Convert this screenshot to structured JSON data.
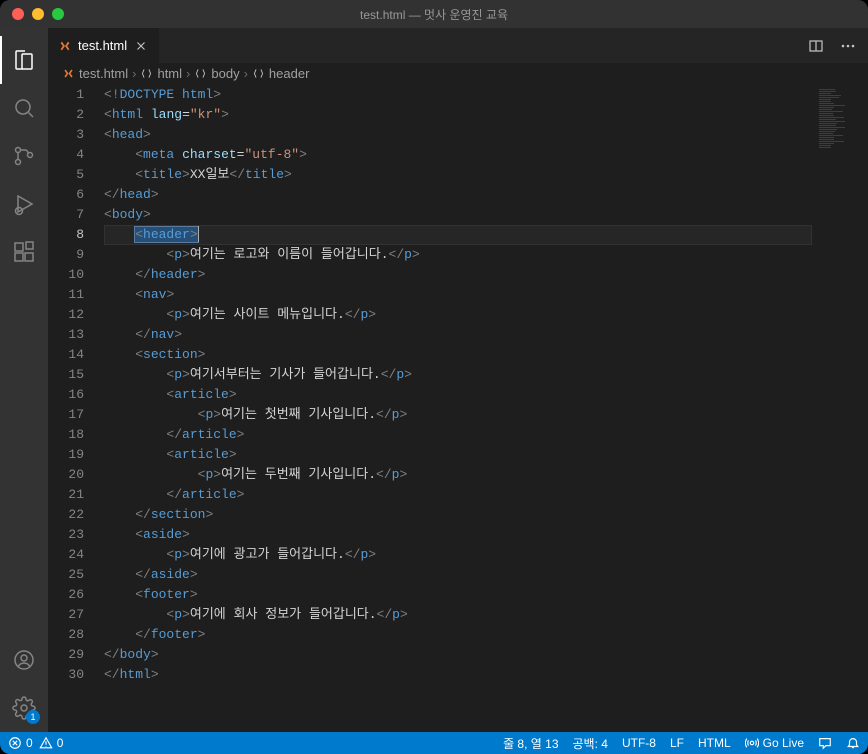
{
  "window": {
    "title": "test.html — 멋사 운영진 교육"
  },
  "tabs": [
    {
      "label": "test.html"
    }
  ],
  "breadcrumbs": [
    "test.html",
    "html",
    "body",
    "header"
  ],
  "cursor": {
    "line": 8,
    "column": 13
  },
  "code": {
    "lines": [
      {
        "n": 1,
        "indent": 0,
        "tokens": [
          {
            "t": "angle",
            "v": "<!"
          },
          {
            "t": "doctype",
            "v": "DOCTYPE html"
          },
          {
            "t": "angle",
            "v": ">"
          }
        ]
      },
      {
        "n": 2,
        "indent": 0,
        "tokens": [
          {
            "t": "angle",
            "v": "<"
          },
          {
            "t": "tag",
            "v": "html"
          },
          {
            "t": "text",
            "v": " "
          },
          {
            "t": "attr",
            "v": "lang"
          },
          {
            "t": "punct",
            "v": "="
          },
          {
            "t": "str",
            "v": "\"kr\""
          },
          {
            "t": "angle",
            "v": ">"
          }
        ]
      },
      {
        "n": 3,
        "indent": 0,
        "tokens": [
          {
            "t": "angle",
            "v": "<"
          },
          {
            "t": "tag",
            "v": "head"
          },
          {
            "t": "angle",
            "v": ">"
          }
        ]
      },
      {
        "n": 4,
        "indent": 1,
        "tokens": [
          {
            "t": "angle",
            "v": "<"
          },
          {
            "t": "tag",
            "v": "meta"
          },
          {
            "t": "text",
            "v": " "
          },
          {
            "t": "attr",
            "v": "charset"
          },
          {
            "t": "punct",
            "v": "="
          },
          {
            "t": "str",
            "v": "\"utf-8\""
          },
          {
            "t": "angle",
            "v": ">"
          }
        ]
      },
      {
        "n": 5,
        "indent": 1,
        "tokens": [
          {
            "t": "angle",
            "v": "<"
          },
          {
            "t": "tag",
            "v": "title"
          },
          {
            "t": "angle",
            "v": ">"
          },
          {
            "t": "text",
            "v": "XX일보"
          },
          {
            "t": "angle",
            "v": "</"
          },
          {
            "t": "tag",
            "v": "title"
          },
          {
            "t": "angle",
            "v": ">"
          }
        ]
      },
      {
        "n": 6,
        "indent": 0,
        "tokens": [
          {
            "t": "angle",
            "v": "</"
          },
          {
            "t": "tag",
            "v": "head"
          },
          {
            "t": "angle",
            "v": ">"
          }
        ]
      },
      {
        "n": 7,
        "indent": 0,
        "tokens": [
          {
            "t": "angle",
            "v": "<"
          },
          {
            "t": "tag",
            "v": "body"
          },
          {
            "t": "angle",
            "v": ">"
          }
        ]
      },
      {
        "n": 8,
        "indent": 1,
        "current": true,
        "tokens": [
          {
            "t": "sel",
            "v": "<header>"
          },
          {
            "t": "cursor"
          }
        ]
      },
      {
        "n": 9,
        "indent": 2,
        "tokens": [
          {
            "t": "angle",
            "v": "<"
          },
          {
            "t": "tag",
            "v": "p"
          },
          {
            "t": "angle",
            "v": ">"
          },
          {
            "t": "text",
            "v": "여기는 로고와 이름이 들어갑니다."
          },
          {
            "t": "angle",
            "v": "</"
          },
          {
            "t": "tag",
            "v": "p"
          },
          {
            "t": "angle",
            "v": ">"
          }
        ]
      },
      {
        "n": 10,
        "indent": 1,
        "tokens": [
          {
            "t": "angle",
            "v": "</"
          },
          {
            "t": "tag",
            "v": "header"
          },
          {
            "t": "angle",
            "v": ">"
          }
        ]
      },
      {
        "n": 11,
        "indent": 1,
        "tokens": [
          {
            "t": "angle",
            "v": "<"
          },
          {
            "t": "tag",
            "v": "nav"
          },
          {
            "t": "angle",
            "v": ">"
          }
        ]
      },
      {
        "n": 12,
        "indent": 2,
        "tokens": [
          {
            "t": "angle",
            "v": "<"
          },
          {
            "t": "tag",
            "v": "p"
          },
          {
            "t": "angle",
            "v": ">"
          },
          {
            "t": "text",
            "v": "여기는 사이트 메뉴입니다."
          },
          {
            "t": "angle",
            "v": "</"
          },
          {
            "t": "tag",
            "v": "p"
          },
          {
            "t": "angle",
            "v": ">"
          }
        ]
      },
      {
        "n": 13,
        "indent": 1,
        "tokens": [
          {
            "t": "angle",
            "v": "</"
          },
          {
            "t": "tag",
            "v": "nav"
          },
          {
            "t": "angle",
            "v": ">"
          }
        ]
      },
      {
        "n": 14,
        "indent": 1,
        "tokens": [
          {
            "t": "angle",
            "v": "<"
          },
          {
            "t": "tag",
            "v": "section"
          },
          {
            "t": "angle",
            "v": ">"
          }
        ]
      },
      {
        "n": 15,
        "indent": 2,
        "tokens": [
          {
            "t": "angle",
            "v": "<"
          },
          {
            "t": "tag",
            "v": "p"
          },
          {
            "t": "angle",
            "v": ">"
          },
          {
            "t": "text",
            "v": "여기서부터는 기사가 들어갑니다."
          },
          {
            "t": "angle",
            "v": "</"
          },
          {
            "t": "tag",
            "v": "p"
          },
          {
            "t": "angle",
            "v": ">"
          }
        ]
      },
      {
        "n": 16,
        "indent": 2,
        "tokens": [
          {
            "t": "angle",
            "v": "<"
          },
          {
            "t": "tag",
            "v": "article"
          },
          {
            "t": "angle",
            "v": ">"
          }
        ]
      },
      {
        "n": 17,
        "indent": 3,
        "tokens": [
          {
            "t": "angle",
            "v": "<"
          },
          {
            "t": "tag",
            "v": "p"
          },
          {
            "t": "angle",
            "v": ">"
          },
          {
            "t": "text",
            "v": "여기는 첫번째 기사입니다."
          },
          {
            "t": "angle",
            "v": "</"
          },
          {
            "t": "tag",
            "v": "p"
          },
          {
            "t": "angle",
            "v": ">"
          }
        ]
      },
      {
        "n": 18,
        "indent": 2,
        "tokens": [
          {
            "t": "angle",
            "v": "</"
          },
          {
            "t": "tag",
            "v": "article"
          },
          {
            "t": "angle",
            "v": ">"
          }
        ]
      },
      {
        "n": 19,
        "indent": 2,
        "tokens": [
          {
            "t": "angle",
            "v": "<"
          },
          {
            "t": "tag",
            "v": "article"
          },
          {
            "t": "angle",
            "v": ">"
          }
        ]
      },
      {
        "n": 20,
        "indent": 3,
        "tokens": [
          {
            "t": "angle",
            "v": "<"
          },
          {
            "t": "tag",
            "v": "p"
          },
          {
            "t": "angle",
            "v": ">"
          },
          {
            "t": "text",
            "v": "여기는 두번째 기사입니다."
          },
          {
            "t": "angle",
            "v": "</"
          },
          {
            "t": "tag",
            "v": "p"
          },
          {
            "t": "angle",
            "v": ">"
          }
        ]
      },
      {
        "n": 21,
        "indent": 2,
        "tokens": [
          {
            "t": "angle",
            "v": "</"
          },
          {
            "t": "tag",
            "v": "article"
          },
          {
            "t": "angle",
            "v": ">"
          }
        ]
      },
      {
        "n": 22,
        "indent": 1,
        "tokens": [
          {
            "t": "angle",
            "v": "</"
          },
          {
            "t": "tag",
            "v": "section"
          },
          {
            "t": "angle",
            "v": ">"
          }
        ]
      },
      {
        "n": 23,
        "indent": 1,
        "tokens": [
          {
            "t": "angle",
            "v": "<"
          },
          {
            "t": "tag",
            "v": "aside"
          },
          {
            "t": "angle",
            "v": ">"
          }
        ]
      },
      {
        "n": 24,
        "indent": 2,
        "tokens": [
          {
            "t": "angle",
            "v": "<"
          },
          {
            "t": "tag",
            "v": "p"
          },
          {
            "t": "angle",
            "v": ">"
          },
          {
            "t": "text",
            "v": "여기에 광고가 들어갑니다."
          },
          {
            "t": "angle",
            "v": "</"
          },
          {
            "t": "tag",
            "v": "p"
          },
          {
            "t": "angle",
            "v": ">"
          }
        ]
      },
      {
        "n": 25,
        "indent": 1,
        "tokens": [
          {
            "t": "angle",
            "v": "</"
          },
          {
            "t": "tag",
            "v": "aside"
          },
          {
            "t": "angle",
            "v": ">"
          }
        ]
      },
      {
        "n": 26,
        "indent": 1,
        "tokens": [
          {
            "t": "angle",
            "v": "<"
          },
          {
            "t": "tag",
            "v": "footer"
          },
          {
            "t": "angle",
            "v": ">"
          }
        ]
      },
      {
        "n": 27,
        "indent": 2,
        "tokens": [
          {
            "t": "angle",
            "v": "<"
          },
          {
            "t": "tag",
            "v": "p"
          },
          {
            "t": "angle",
            "v": ">"
          },
          {
            "t": "text",
            "v": "여기에 회사 정보가 들어갑니다."
          },
          {
            "t": "angle",
            "v": "</"
          },
          {
            "t": "tag",
            "v": "p"
          },
          {
            "t": "angle",
            "v": ">"
          }
        ]
      },
      {
        "n": 28,
        "indent": 1,
        "tokens": [
          {
            "t": "angle",
            "v": "</"
          },
          {
            "t": "tag",
            "v": "footer"
          },
          {
            "t": "angle",
            "v": ">"
          }
        ]
      },
      {
        "n": 29,
        "indent": 0,
        "tokens": [
          {
            "t": "angle",
            "v": "</"
          },
          {
            "t": "tag",
            "v": "body"
          },
          {
            "t": "angle",
            "v": ">"
          }
        ]
      },
      {
        "n": 30,
        "indent": 0,
        "tokens": [
          {
            "t": "angle",
            "v": "</"
          },
          {
            "t": "tag",
            "v": "html"
          },
          {
            "t": "angle",
            "v": ">"
          }
        ]
      }
    ]
  },
  "status": {
    "errors": "0",
    "warnings": "0",
    "lnCol": "줄 8, 열 13",
    "spaces": "공백: 4",
    "encoding": "UTF-8",
    "eol": "LF",
    "language": "HTML",
    "golive": "Go Live"
  },
  "settingsBadge": "1"
}
